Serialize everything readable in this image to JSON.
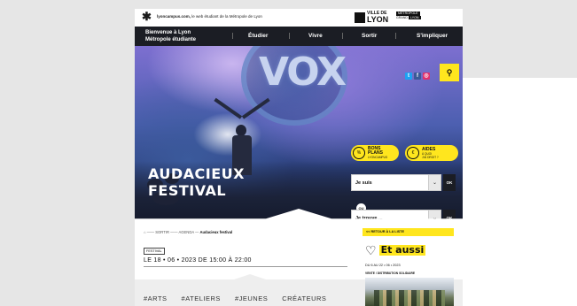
{
  "topbar": {
    "site": "lyoncampus.com,",
    "tagline_rest": " le web étudiant de la Métropole de Lyon",
    "lyon_small": "VILLE DE",
    "lyon_big": "LYON",
    "metro_line1": "MÉTROPOLE",
    "metro_line2": "GRAND",
    "metro_line3": "LYON"
  },
  "nav": {
    "welcome_line1": "Bienvenue à Lyon",
    "welcome_line2": "Métropole étudiante",
    "items": [
      "Étudier",
      "Vivre",
      "Sortir",
      "S'impliquer"
    ]
  },
  "hero": {
    "vox": "VOX",
    "title_line1": "AUDACIEUX",
    "title_line2": "FESTIVAL",
    "bons_plans_line1": "BONS",
    "bons_plans_line2": "PLANS",
    "bons_plans_sub": "LYONCAMPUS",
    "aides_line1": "AIDES",
    "aides_sub1": "À QUOI",
    "aides_sub2": "J'AI DROIT ?",
    "select1": "Je suis",
    "select2": "Je trouve ...",
    "ok_label": "OK",
    "ou_label": "OU"
  },
  "content": {
    "breadcrumb": [
      "SORTIR",
      "AGENDA",
      "Audacieux festival"
    ],
    "festival_tag": "FESTIVAL",
    "date": "LE 18 • 06 • 2023 DE 15:00 À 22:00",
    "tags": [
      "#ARTS",
      "#ATELIERS",
      "#JEUNES",
      "CRÉATEURS"
    ]
  },
  "sidebar": {
    "retour": "<< RETOUR À LA LISTE",
    "et_aussi": "Et aussi",
    "event_date": "DU 6 AU 22 • 06 • 2023",
    "event_type": "VENTE / DISTRIBUTION SOLIDAIRE"
  }
}
